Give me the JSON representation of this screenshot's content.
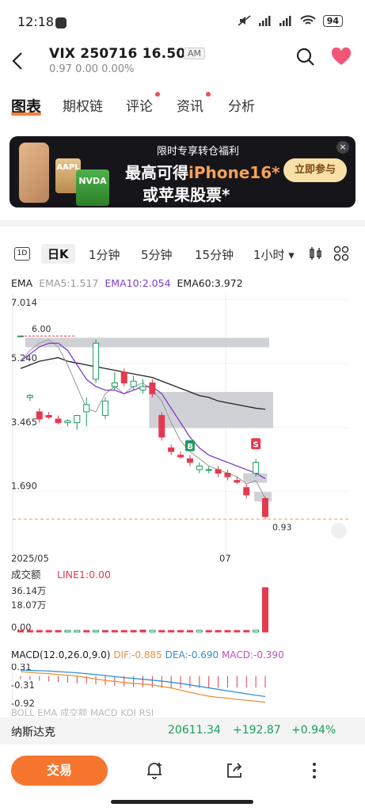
{
  "status": {
    "time": "12:18",
    "battery": "94",
    "signal_label": "6"
  },
  "header": {
    "title": "VIX 250716 16.50C",
    "session_badge": "AM",
    "subtitle": "0.97  0.00  0.00%"
  },
  "tabs": [
    {
      "label": "图表"
    },
    {
      "label": "期权链"
    },
    {
      "label": "评论"
    },
    {
      "label": "资讯"
    },
    {
      "label": "分析"
    }
  ],
  "banner": {
    "line1": "限时专享转仓福利",
    "line2_prefix": "最高可得",
    "line2_highlight": "iPhone16*",
    "line3": "或苹果股票*",
    "card1": "AAPL",
    "card2": "NVDA",
    "cta": "立即参与",
    "close": "×"
  },
  "periods": {
    "day_icon": "1D",
    "items": [
      {
        "label": "日K"
      },
      {
        "label": "1分钟"
      },
      {
        "label": "5分钟"
      },
      {
        "label": "15分钟"
      },
      {
        "label": "1小时 ▾"
      }
    ]
  },
  "ema_legend": {
    "title": "EMA",
    "ema5": "EMA5:1.517",
    "ema10": "EMA10:2.054",
    "ema60": "EMA60:3.972"
  },
  "chart_data": {
    "type": "candlestick",
    "y_ticks": [
      "7.014",
      "5.240",
      "3.465",
      "1.690"
    ],
    "x_ticks": [
      "2025/05",
      "07"
    ],
    "max_label": "6.00",
    "min_label": "0.93",
    "buy_marker": "B",
    "sell_marker": "S",
    "ylim": [
      0.5,
      7.014
    ],
    "candles": [
      {
        "o": 6.0,
        "h": 6.0,
        "l": 6.0,
        "c": 6.0
      },
      {
        "o": 4.3,
        "h": 4.4,
        "l": 4.2,
        "c": 4.35
      },
      {
        "o": 3.9,
        "h": 4.0,
        "l": 3.6,
        "c": 3.7
      },
      {
        "o": 3.8,
        "h": 3.9,
        "l": 3.7,
        "c": 3.75
      },
      {
        "o": 3.7,
        "h": 3.8,
        "l": 3.55,
        "c": 3.6
      },
      {
        "o": 3.6,
        "h": 3.7,
        "l": 3.5,
        "c": 3.65
      },
      {
        "o": 3.6,
        "h": 3.8,
        "l": 3.4,
        "c": 3.8
      },
      {
        "o": 3.9,
        "h": 4.3,
        "l": 3.5,
        "c": 4.1
      },
      {
        "o": 4.8,
        "h": 5.9,
        "l": 4.7,
        "c": 5.8
      },
      {
        "o": 3.8,
        "h": 4.3,
        "l": 3.7,
        "c": 4.2
      },
      {
        "o": 4.6,
        "h": 5.0,
        "l": 4.5,
        "c": 4.7
      },
      {
        "o": 5.0,
        "h": 5.1,
        "l": 4.6,
        "c": 4.7
      },
      {
        "o": 4.6,
        "h": 4.9,
        "l": 4.5,
        "c": 4.75
      },
      {
        "o": 4.5,
        "h": 4.8,
        "l": 4.4,
        "c": 4.6
      },
      {
        "o": 4.7,
        "h": 4.8,
        "l": 4.3,
        "c": 4.4
      },
      {
        "o": 3.8,
        "h": 3.9,
        "l": 3.1,
        "c": 3.2
      },
      {
        "o": 2.9,
        "h": 3.0,
        "l": 2.7,
        "c": 2.8
      },
      {
        "o": 2.7,
        "h": 2.8,
        "l": 2.6,
        "c": 2.65
      },
      {
        "o": 2.6,
        "h": 2.7,
        "l": 2.4,
        "c": 2.5
      },
      {
        "o": 2.3,
        "h": 2.5,
        "l": 2.2,
        "c": 2.4
      },
      {
        "o": 2.3,
        "h": 2.4,
        "l": 2.2,
        "c": 2.3
      },
      {
        "o": 2.3,
        "h": 2.4,
        "l": 2.1,
        "c": 2.2
      },
      {
        "o": 2.2,
        "h": 2.3,
        "l": 2.0,
        "c": 2.1
      },
      {
        "o": 2.0,
        "h": 2.1,
        "l": 1.9,
        "c": 1.95
      },
      {
        "o": 1.8,
        "h": 1.9,
        "l": 1.5,
        "c": 1.6
      },
      {
        "o": 2.2,
        "h": 2.6,
        "l": 2.1,
        "c": 2.5
      },
      {
        "o": 1.5,
        "h": 1.55,
        "l": 0.93,
        "c": 1.0
      }
    ],
    "ema5": [
      5.3,
      5.6,
      5.8,
      5.9,
      5.7,
      5.2,
      4.6,
      4.0,
      3.9,
      4.4,
      4.6,
      4.4,
      4.6,
      4.7,
      4.5,
      4.2,
      3.6,
      3.1,
      2.8,
      2.6,
      2.4,
      2.3,
      2.2,
      2.1,
      1.9,
      2.0,
      1.5
    ],
    "ema10": [
      5.3,
      5.5,
      5.7,
      5.8,
      5.8,
      5.6,
      5.2,
      4.8,
      4.6,
      4.5,
      4.5,
      4.4,
      4.5,
      4.6,
      4.6,
      4.4,
      4.0,
      3.6,
      3.2,
      2.9,
      2.7,
      2.6,
      2.5,
      2.4,
      2.3,
      2.2,
      2.05
    ],
    "ema60": [
      5.1,
      5.2,
      5.3,
      5.35,
      5.4,
      5.3,
      5.25,
      5.2,
      5.15,
      5.1,
      5.05,
      5.0,
      4.95,
      4.9,
      4.85,
      4.75,
      4.65,
      4.55,
      4.45,
      4.35,
      4.3,
      4.2,
      4.15,
      4.1,
      4.05,
      4.0,
      3.97
    ],
    "volume_ticks": [
      "36.14万",
      "18.07万",
      "0.00"
    ],
    "volume_legend": "成交额",
    "volume_line": "LINE1:0.00",
    "volumes": [
      0.4,
      0.5,
      0.6,
      0.7,
      0.5,
      0.6,
      0.9,
      0.8,
      1.2,
      1.0,
      1.1,
      0.9,
      1.3,
      1.6,
      1.4,
      1.2,
      0.8,
      1.1,
      1.2,
      1.4,
      1.0,
      1.0,
      1.2,
      1.1,
      1.3,
      1.5,
      36.14
    ],
    "volume_up": [
      false,
      false,
      false,
      false,
      false,
      true,
      true,
      false,
      true,
      false,
      false,
      false,
      false,
      false,
      true,
      false,
      false,
      false,
      false,
      true,
      false,
      false,
      false,
      false,
      false,
      true,
      false
    ],
    "macd_ticks": [
      "0.31",
      "-0.31",
      "-0.92"
    ],
    "macd": [
      -0.1,
      -0.13,
      -0.16,
      -0.18,
      -0.2,
      -0.22,
      -0.24,
      -0.26,
      -0.28,
      -0.3,
      -0.33,
      -0.35,
      -0.37,
      -0.38,
      -0.39,
      -0.4,
      -0.41,
      -0.41,
      -0.4,
      -0.4,
      -0.39,
      -0.39,
      -0.39,
      -0.39,
      -0.39,
      -0.39,
      -0.39
    ],
    "dif": [
      0.15,
      0.12,
      0.1,
      0.08,
      0.05,
      0.03,
      0.0,
      -0.05,
      -0.1,
      -0.15,
      -0.18,
      -0.22,
      -0.25,
      -0.27,
      -0.3,
      -0.35,
      -0.4,
      -0.48,
      -0.55,
      -0.62,
      -0.68,
      -0.72,
      -0.75,
      -0.79,
      -0.82,
      -0.85,
      -0.885
    ],
    "dea": [
      0.2,
      0.19,
      0.18,
      0.17,
      0.15,
      0.13,
      0.11,
      0.08,
      0.05,
      0.02,
      -0.02,
      -0.05,
      -0.08,
      -0.11,
      -0.14,
      -0.17,
      -0.21,
      -0.25,
      -0.3,
      -0.35,
      -0.4,
      -0.45,
      -0.5,
      -0.55,
      -0.6,
      -0.65,
      -0.69
    ]
  },
  "macd_legend": {
    "title": "MACD(12.0,26.0,9.0)",
    "dif": "DIF:-0.885",
    "dea": "DEA:-0.690",
    "macd": "MACD:-0.390"
  },
  "indicator_tabs": "BOLL EMA 成交额 MACD KDJ RSI",
  "bottom_ticker": {
    "name": "纳斯达克",
    "price": "20611.34",
    "change": "+192.87",
    "pct": "+0.94%"
  },
  "actions": {
    "trade": "交易"
  },
  "colors": {
    "accent": "#f5752e",
    "up": "#e23b4f",
    "down": "#1a9e5c",
    "ema5": "#999999",
    "ema10": "#7d3ccf",
    "ema60": "#222222",
    "dif": "#e8923a",
    "dea": "#2f8fd6"
  }
}
